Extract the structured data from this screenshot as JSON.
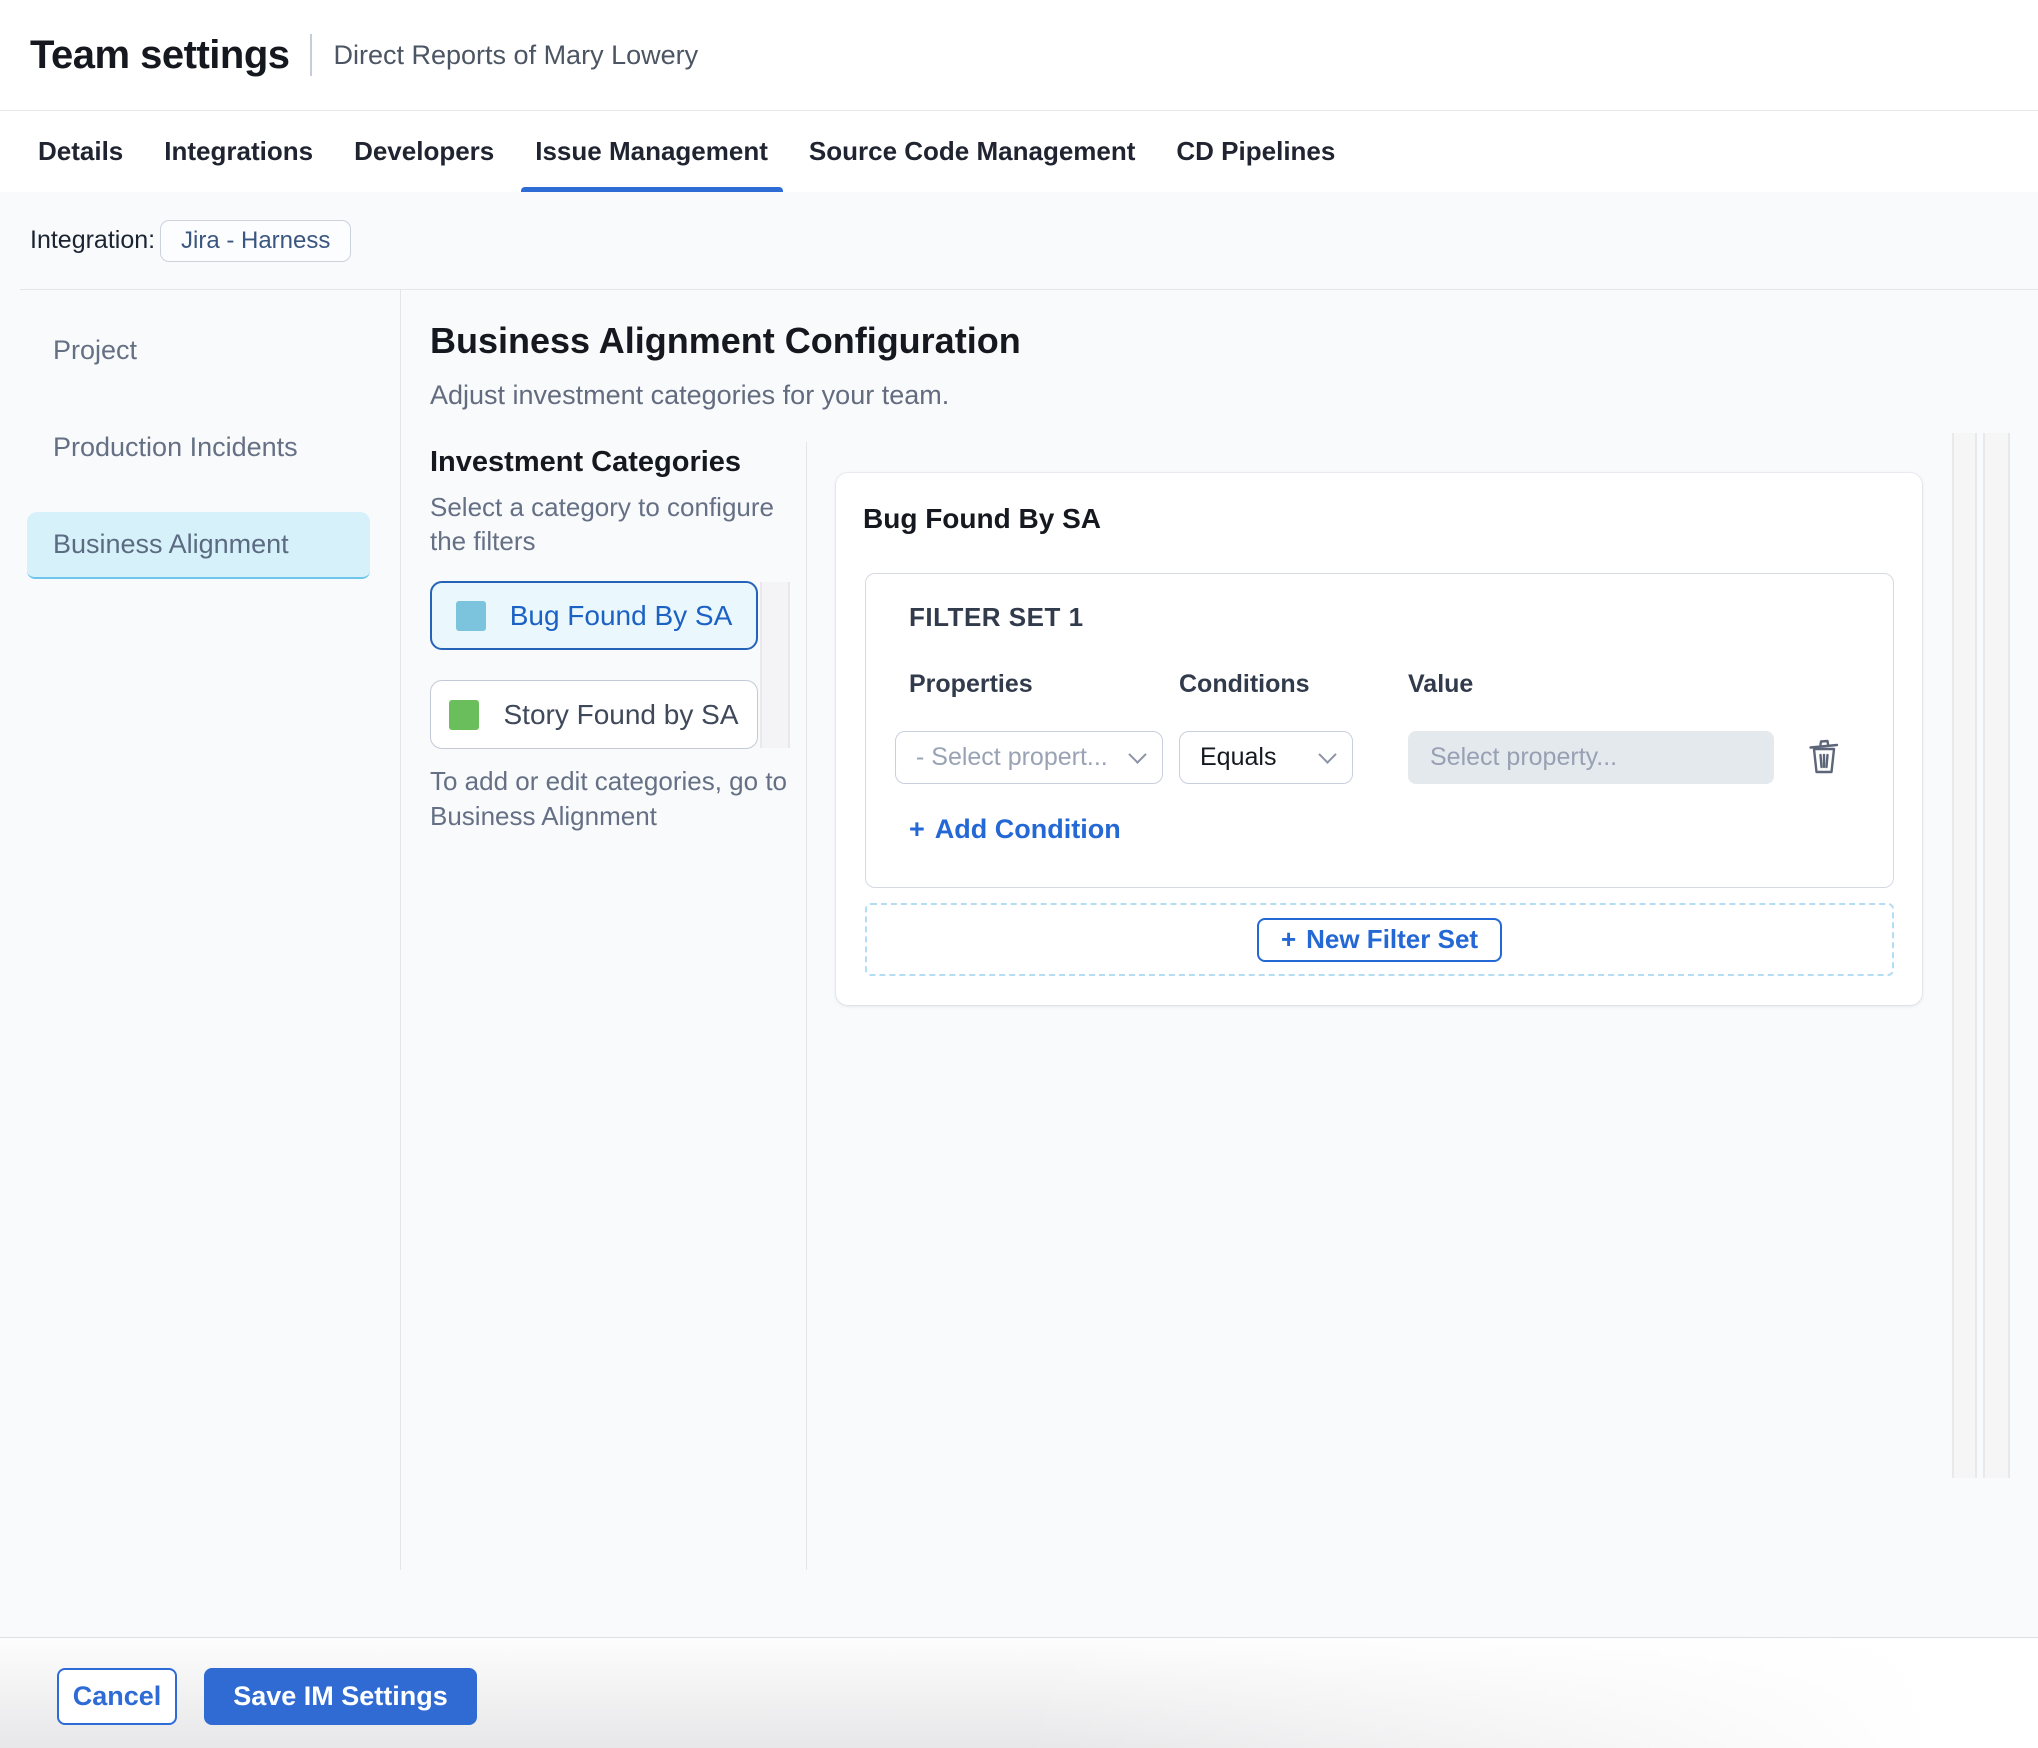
{
  "icons": {
    "plus": "+"
  },
  "colors": {
    "accent_blue": "#2e6cd5",
    "link_blue": "#2468d5",
    "active_tab_underline": "#2e6cd5",
    "sidebar_active_bg": "#d7f1fa",
    "selected_category_bg": "#eaf7fc",
    "bug_swatch": "#7cc3de",
    "story_swatch": "#6abf5c",
    "value_input_bg": "#e4e9ee"
  },
  "header": {
    "title": "Team settings",
    "subtitle": "Direct Reports of Mary Lowery"
  },
  "tabs": {
    "active": "Issue Management",
    "items": [
      {
        "label": "Details"
      },
      {
        "label": "Integrations"
      },
      {
        "label": "Developers"
      },
      {
        "label": "Issue Management"
      },
      {
        "label": "Source Code Management"
      },
      {
        "label": "CD Pipelines"
      }
    ]
  },
  "integration": {
    "label": "Integration:",
    "value": "Jira - Harness"
  },
  "sidebar": {
    "active": "Business Alignment",
    "items": [
      {
        "label": "Project"
      },
      {
        "label": "Production Incidents"
      },
      {
        "label": "Business Alignment"
      }
    ]
  },
  "main": {
    "title": "Business Alignment Configuration",
    "subtitle": "Adjust investment categories for your team.",
    "categories": {
      "heading": "Investment Categories",
      "description": "Select a category to configure the filters",
      "items": [
        {
          "label": "Bug Found By SA",
          "swatch_color": "#7cc3de",
          "selected": true
        },
        {
          "label": "Story Found by SA",
          "swatch_color": "#6abf5c",
          "selected": false
        }
      ],
      "note": "To add or edit categories, go to Business Alignment"
    },
    "panel": {
      "title": "Bug Found By SA",
      "filter_set": {
        "heading": "FILTER SET 1",
        "columns": [
          "Properties",
          "Conditions",
          "Value"
        ],
        "property_placeholder": "- Select propert...",
        "condition_value": "Equals",
        "value_placeholder": "Select property...",
        "add_condition_label": "Add Condition"
      },
      "new_filter_set_label": "New Filter Set"
    }
  },
  "footer": {
    "cancel_label": "Cancel",
    "save_label": "Save IM Settings"
  }
}
